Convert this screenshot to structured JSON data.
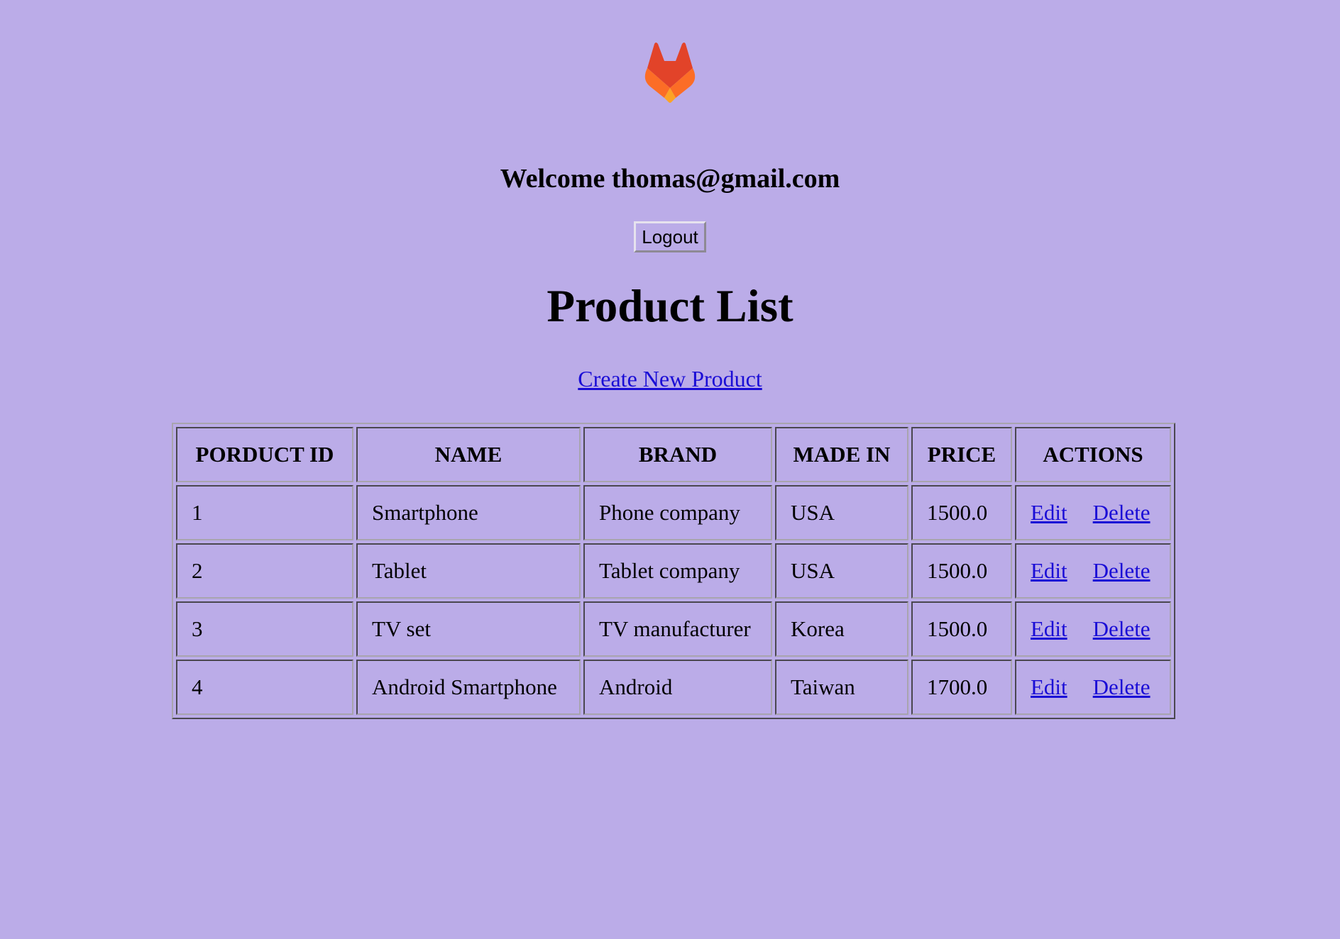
{
  "header": {
    "logo_icon": "gitlab-fox-logo-icon",
    "welcome_text": "Welcome thomas@gmail.com",
    "logout_label": "Logout"
  },
  "main": {
    "title": "Product List",
    "create_link_label": "Create New Product"
  },
  "colors": {
    "background": "#bbace8",
    "link": "#1a0dd6",
    "logo_red": "#e24329",
    "logo_orange": "#fc6d26",
    "logo_yellow": "#fca326"
  },
  "table": {
    "headers": [
      "PORDUCT ID",
      "NAME",
      "BRAND",
      "MADE IN",
      "PRICE",
      "ACTIONS"
    ],
    "rows": [
      {
        "id": "1",
        "name": "Smartphone",
        "brand": "Phone company",
        "made_in": "USA",
        "price": "1500.0",
        "edit": "Edit",
        "delete": "Delete"
      },
      {
        "id": "2",
        "name": "Tablet",
        "brand": "Tablet company",
        "made_in": "USA",
        "price": "1500.0",
        "edit": "Edit",
        "delete": "Delete"
      },
      {
        "id": "3",
        "name": "TV set",
        "brand": "TV manufacturer",
        "made_in": "Korea",
        "price": "1500.0",
        "edit": "Edit",
        "delete": "Delete"
      },
      {
        "id": "4",
        "name": "Android Smartphone",
        "brand": "Android",
        "made_in": "Taiwan",
        "price": "1700.0",
        "edit": "Edit",
        "delete": "Delete"
      }
    ]
  }
}
